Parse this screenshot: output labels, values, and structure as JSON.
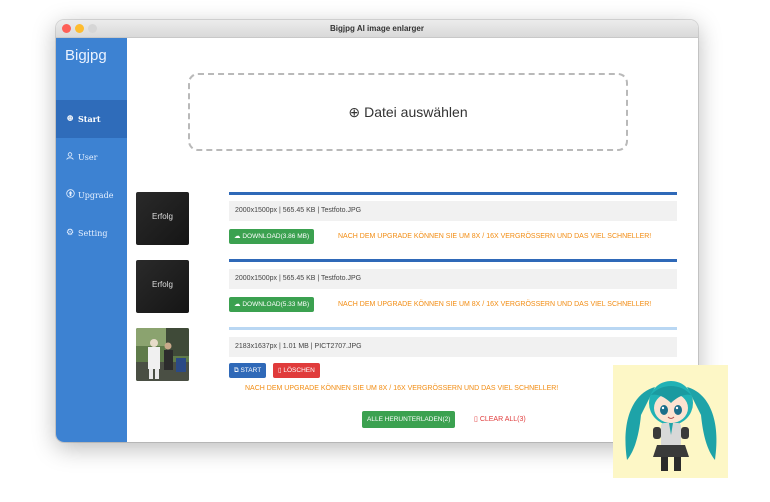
{
  "window": {
    "title": "Bigjpg AI image enlarger"
  },
  "sidebar": {
    "logo": "Bigjpg",
    "items": [
      {
        "label": "Start",
        "icon": "plus-circle-icon",
        "active": true
      },
      {
        "label": "User",
        "icon": "user-icon",
        "active": false
      },
      {
        "label": "Upgrade",
        "icon": "upgrade-icon",
        "active": false
      },
      {
        "label": "Setting",
        "icon": "gear-icon",
        "active": false
      }
    ]
  },
  "upload": {
    "label": "Datei auswählen"
  },
  "files": [
    {
      "status": "Erfolg",
      "info": "2000x1500px | 565.45 KB | Testfoto.JPG",
      "download_label": "DOWNLOAD(3.86 MB)",
      "upgrade_note": "NACH DEM UPGRADE KÖNNEN SIE UM 8X / 16X VERGRÖSSERN UND DAS VIEL SCHNELLER!"
    },
    {
      "status": "Erfolg",
      "info": "2000x1500px | 565.45 KB | Testfoto.JPG",
      "download_label": "DOWNLOAD(5.33 MB)",
      "upgrade_note": "NACH DEM UPGRADE KÖNNEN SIE UM 8X / 16X VERGRÖSSERN UND DAS VIEL SCHNELLER!"
    },
    {
      "info": "2183x1637px | 1.01 MB | PICT2707.JPG",
      "start_label": "START",
      "delete_label": "LÖSCHEN",
      "upgrade_note": "NACH DEM UPGRADE KÖNNEN SIE UM 8X / 16X VERGRÖSSERN UND DAS VIEL SCHNELLER!"
    }
  ],
  "actions": {
    "download_all_label": "ALLE HERUNTERLADEN(2)",
    "clear_all_label": "CLEAR ALL(3)"
  },
  "colors": {
    "sidebar": "#3d82d2",
    "sidebar_active": "#2f6cba",
    "green": "#3ba150",
    "blue": "#2f69b8",
    "red": "#e03b3b",
    "orange": "#f28c12"
  }
}
